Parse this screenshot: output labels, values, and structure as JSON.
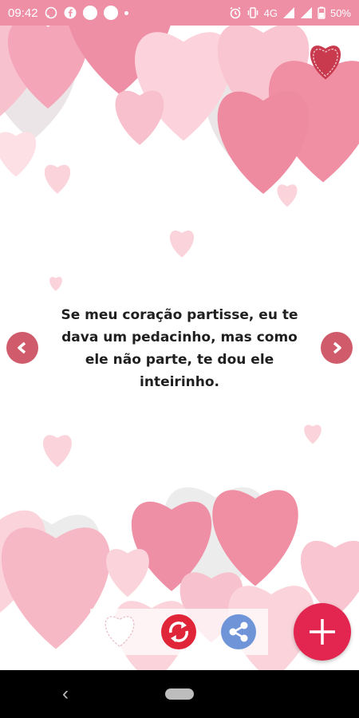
{
  "status_bar": {
    "time": "09:42",
    "network": "4G",
    "battery": "50%"
  },
  "quote": {
    "text": "Se meu coração partisse, eu te dava um pedacinho, mas como ele não parte, te dou ele inteirinho."
  },
  "nav": {
    "prev_icon": "chevron-left-icon",
    "next_icon": "chevron-right-icon"
  },
  "toolbar": {
    "icons": [
      "heart-outline-icon",
      "refresh-icon",
      "share-icon"
    ]
  },
  "fab": {
    "icon": "plus-icon"
  },
  "colors": {
    "status_bar": "#ee8fa6",
    "accent": "#e32650",
    "nav_button": "#cf5b6b",
    "refresh": "#e12538",
    "share": "#6f94d8"
  }
}
